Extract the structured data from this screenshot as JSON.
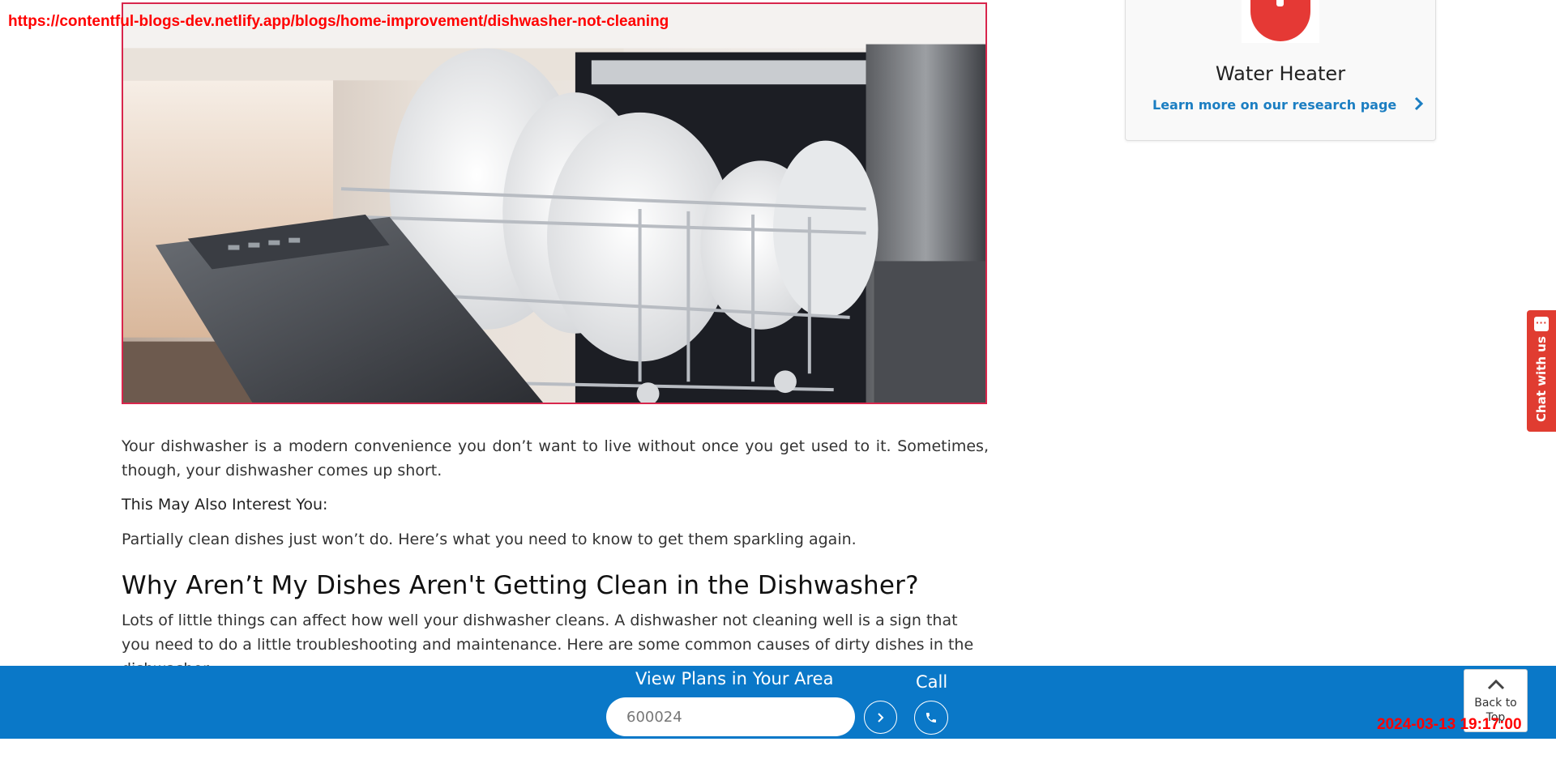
{
  "overlay": {
    "url": "https://contentful-blogs-dev.netlify.app/blogs/home-improvement/dishwasher-not-cleaning",
    "timestamp": "2024-03-13 19:17:00"
  },
  "hero": {
    "image_icon": "dishwasher-photo"
  },
  "article": {
    "paragraph_1": "Your dishwasher is a modern convenience you don’t want to live without once you get used to it. Sometimes, though, your dishwasher comes up short.",
    "interest_label": "This May Also Interest You:",
    "paragraph_2": "Partially clean dishes just won’t do. Here’s what you need to know to get them sparkling again.",
    "heading": "Why Aren’t My Dishes Aren't Getting Clean in the Dishwasher?",
    "paragraph_3": "Lots of little things can affect how well your dishwasher cleans. A dishwasher not cleaning well is a sign that you need to do a little troubleshooting and maintenance. Here are some common causes of dirty dishes in the dishwasher."
  },
  "sidebar": {
    "card_title": "Water Heater",
    "card_link": "Learn more on our research page",
    "icon": "water-heater-icon",
    "link_icon": "chevron-right-icon"
  },
  "chat": {
    "label": "Chat with us",
    "icon": "chat-bubble-icon"
  },
  "bottom_bar": {
    "plans_title": "View Plans in Your Area",
    "zip_value": "600024",
    "call_label": "Call",
    "go_icon": "chevron-right-icon",
    "call_icon": "phone-icon",
    "background_color": "#0a78c8"
  },
  "back_to_top": {
    "label": "Back to Top",
    "icon": "chevron-up-icon"
  },
  "colors": {
    "accent_red": "#e03c31",
    "link_blue": "#1b7ec2",
    "bar_blue": "#0a78c8"
  }
}
